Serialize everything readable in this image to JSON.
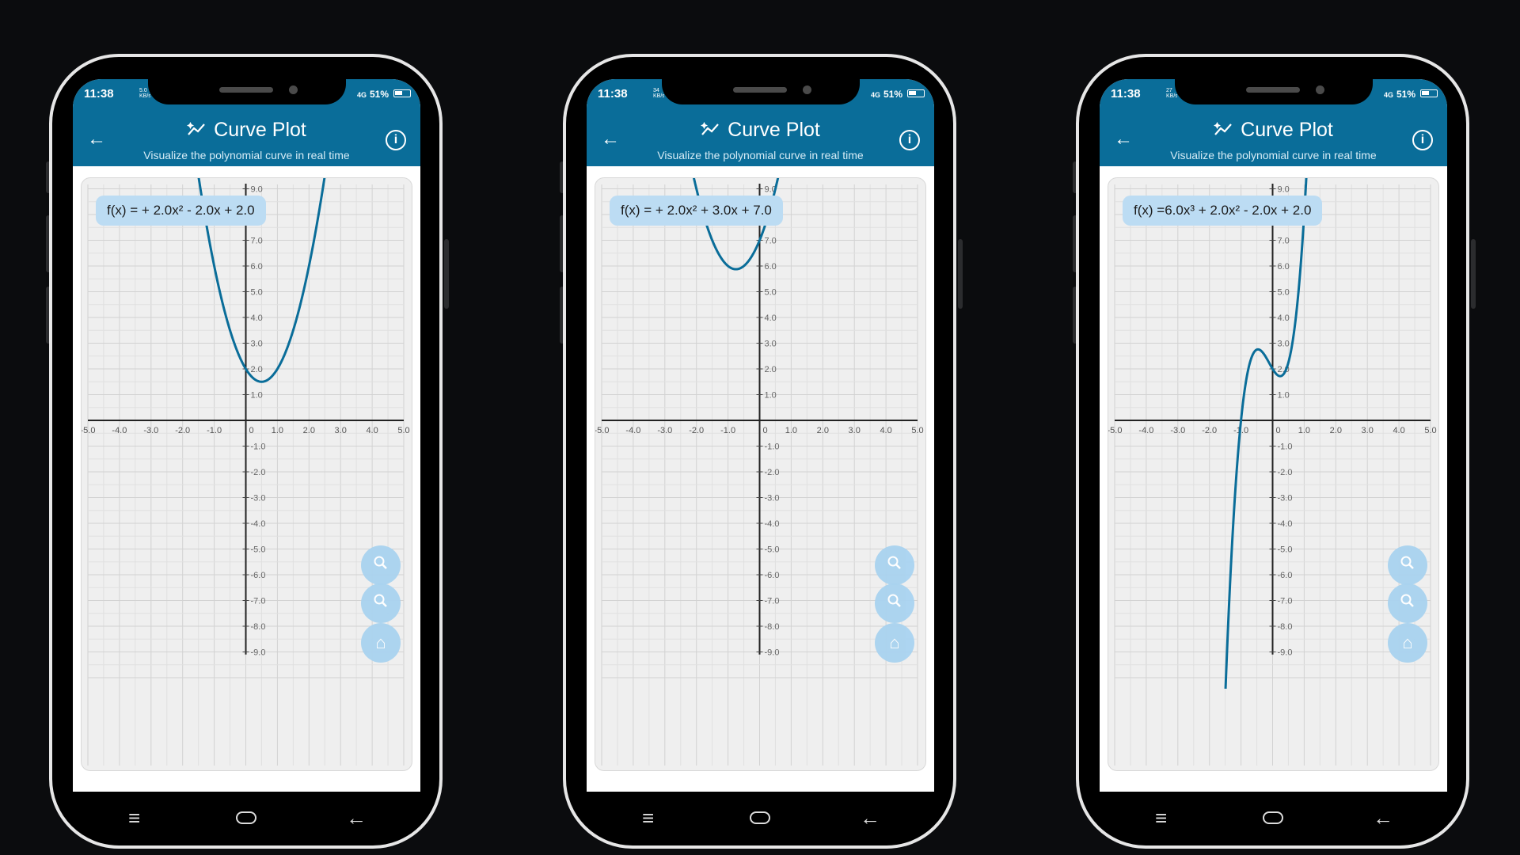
{
  "colors": {
    "appbar": "#0a6d99",
    "curve": "#0a6d99",
    "fab": "#a9d3f0",
    "pill": "#bcdcf3"
  },
  "icons": {
    "back": "arrow-left-icon",
    "title": "chart-sparkle-icon",
    "info": "info-circle-icon",
    "zoom_in": "zoom-in-icon",
    "zoom_out": "zoom-out-icon",
    "home": "home-icon",
    "nav_menu": "menu-icon",
    "nav_home": "home-pill-icon",
    "nav_back": "back-arrow-icon"
  },
  "phones": [
    {
      "status": {
        "time": "11:38",
        "kb": "5.0 KB/s",
        "network": "4G",
        "battery": "51%"
      },
      "appbar": {
        "title": "Curve Plot",
        "subtitle": "Visualize the polynomial curve in real time"
      },
      "formula": "f(x) = + 2.0x² - 2.0x + 2.0",
      "chart_data": {
        "type": "line",
        "coefficients": [
          0,
          2.0,
          -2.0,
          2.0
        ],
        "xlim": [
          -5,
          5
        ],
        "ylim": [
          -9,
          9
        ],
        "grid": true
      }
    },
    {
      "status": {
        "time": "11:38",
        "kb": "34 KB/s",
        "network": "4G",
        "battery": "51%"
      },
      "appbar": {
        "title": "Curve Plot",
        "subtitle": "Visualize the polynomial curve in real time"
      },
      "formula": "f(x) = + 2.0x² + 3.0x + 7.0",
      "chart_data": {
        "type": "line",
        "coefficients": [
          0,
          2.0,
          3.0,
          7.0
        ],
        "xlim": [
          -5,
          5
        ],
        "ylim": [
          -9,
          9
        ],
        "grid": true
      }
    },
    {
      "status": {
        "time": "11:38",
        "kb": "27 KB/s",
        "network": "4G",
        "battery": "51%"
      },
      "appbar": {
        "title": "Curve Plot",
        "subtitle": "Visualize the polynomial curve in real time"
      },
      "formula": "f(x) =6.0x³ + 2.0x² - 2.0x + 2.0",
      "chart_data": {
        "type": "line",
        "coefficients": [
          6.0,
          2.0,
          -2.0,
          2.0
        ],
        "xlim": [
          -5,
          5
        ],
        "ylim": [
          -9,
          9
        ],
        "grid": true
      }
    }
  ],
  "axis_ticks": {
    "x": [
      "-5.0",
      "-4.0",
      "-3.0",
      "-2.0",
      "-1.0",
      "0",
      "1.0",
      "2.0",
      "3.0",
      "4.0",
      "5.0"
    ],
    "y": [
      "9.0",
      "8.0",
      "7.0",
      "6.0",
      "5.0",
      "4.0",
      "3.0",
      "2.0",
      "1.0",
      "-1.0",
      "-2.0",
      "-3.0",
      "-4.0",
      "-5.0",
      "-6.0",
      "-7.0",
      "-8.0",
      "-9.0"
    ]
  }
}
